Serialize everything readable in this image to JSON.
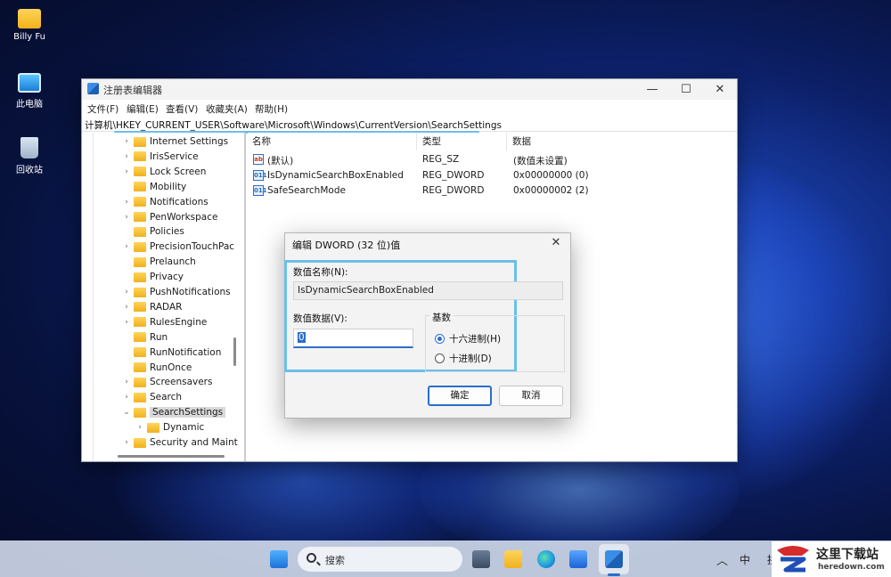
{
  "desktop": {
    "icons": [
      {
        "label": "Billy Fu",
        "icon": "folder-icon"
      },
      {
        "label": "此电脑",
        "icon": "this-pc-icon"
      },
      {
        "label": "回收站",
        "icon": "recycle-bin-icon"
      }
    ]
  },
  "window": {
    "title": "注册表编辑器",
    "controls": {
      "minimize": "—",
      "maximize": "☐",
      "close": "✕"
    },
    "menu": [
      "文件(F)",
      "编辑(E)",
      "查看(V)",
      "收藏夹(A)",
      "帮助(H)"
    ],
    "address": "计算机\\HKEY_CURRENT_USER\\Software\\Microsoft\\Windows\\CurrentVersion\\SearchSettings",
    "tree": [
      {
        "label": "Internet Settings",
        "expandable": true
      },
      {
        "label": "IrisService",
        "expandable": true
      },
      {
        "label": "Lock Screen",
        "expandable": true
      },
      {
        "label": "Mobility",
        "expandable": false
      },
      {
        "label": "Notifications",
        "expandable": true
      },
      {
        "label": "PenWorkspace",
        "expandable": true
      },
      {
        "label": "Policies",
        "expandable": false
      },
      {
        "label": "PrecisionTouchPac",
        "expandable": true
      },
      {
        "label": "Prelaunch",
        "expandable": false
      },
      {
        "label": "Privacy",
        "expandable": false
      },
      {
        "label": "PushNotifications",
        "expandable": true
      },
      {
        "label": "RADAR",
        "expandable": true
      },
      {
        "label": "RulesEngine",
        "expandable": true
      },
      {
        "label": "Run",
        "expandable": false
      },
      {
        "label": "RunNotification",
        "expandable": false
      },
      {
        "label": "RunOnce",
        "expandable": false
      },
      {
        "label": "Screensavers",
        "expandable": true
      },
      {
        "label": "Search",
        "expandable": true
      },
      {
        "label": "SearchSettings",
        "expandable": true,
        "expanded": true,
        "selected": true
      },
      {
        "label": "Dynamic",
        "expandable": true,
        "child": true
      },
      {
        "label": "Security and Maint",
        "expandable": true
      }
    ],
    "columns": {
      "name": "名称",
      "type": "类型",
      "data": "数据"
    },
    "values": [
      {
        "icon": "ab",
        "name": "(默认)",
        "type": "REG_SZ",
        "data": "(数值未设置)"
      },
      {
        "icon": "011",
        "name": "IsDynamicSearchBoxEnabled",
        "type": "REG_DWORD",
        "data": "0x00000000 (0)"
      },
      {
        "icon": "011",
        "name": "SafeSearchMode",
        "type": "REG_DWORD",
        "data": "0x00000002 (2)"
      }
    ]
  },
  "dialog": {
    "title": "编辑 DWORD (32 位)值",
    "close": "✕",
    "name_label": "数值名称(N):",
    "name_value": "IsDynamicSearchBoxEnabled",
    "data_label": "数值数据(V):",
    "data_value": "0",
    "base_label": "基数",
    "hex_label": "十六进制(H)",
    "dec_label": "十进制(D)",
    "hex_selected": true,
    "ok": "确定",
    "cancel": "取消"
  },
  "taskbar": {
    "search_text": "搜索",
    "tray_chevron": "︿",
    "ime": "中",
    "ime2": "拼"
  },
  "watermark": {
    "title": "这里下载站",
    "subtitle": "heredown.com"
  }
}
